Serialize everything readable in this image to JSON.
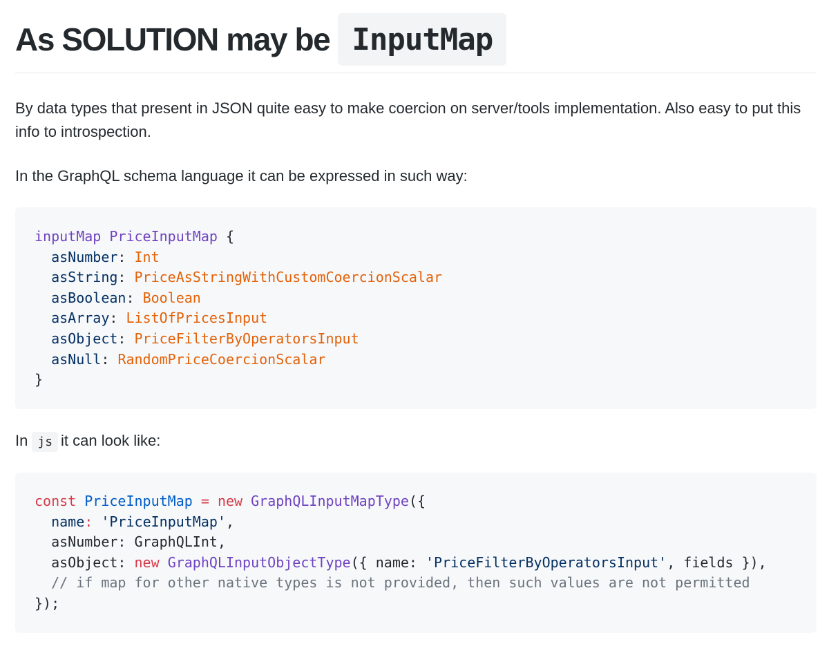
{
  "heading": {
    "text": "As SOLUTION may be",
    "code": "InputMap"
  },
  "paragraphs": {
    "p1": "By data types that present in JSON quite easy to make coercion on server/tools implementation. Also easy to put this info to introspection.",
    "p2": "In the GraphQL schema language it can be expressed in such way:",
    "p3_before": "In",
    "p3_code": "js",
    "p3_after": "it can look like:"
  },
  "graphql_code": {
    "l1": [
      "inputMap",
      "PriceInputMap",
      "{"
    ],
    "fields": [
      {
        "name": "asNumber",
        "type": "Int"
      },
      {
        "name": "asString",
        "type": "PriceAsStringWithCustomCoercionScalar"
      },
      {
        "name": "asBoolean",
        "type": "Boolean"
      },
      {
        "name": "asArray",
        "type": "ListOfPricesInput"
      },
      {
        "name": "asObject",
        "type": "PriceFilterByOperatorsInput"
      },
      {
        "name": "asNull",
        "type": "RandomPriceCoercionScalar"
      }
    ],
    "close": "}"
  },
  "js_code": {
    "l1": {
      "const": "const",
      "var": "PriceInputMap",
      "eq": "=",
      "new": "new",
      "fn": "GraphQLInputMapType",
      "open": "({"
    },
    "l2": {
      "key": "name",
      "str": "'PriceInputMap'",
      "tail": ","
    },
    "l3": {
      "key": "asNumber",
      "val": "GraphQLInt",
      "tail": ","
    },
    "l4": {
      "key": "asObject",
      "new": "new",
      "fn": "GraphQLInputObjectType",
      "open": "({",
      "key2": "name",
      "str": "'PriceFilterByOperatorsInput'",
      "rest": ", fields }),"
    },
    "l5": "// if map for other native types is not provided, then such values are not permitted",
    "l6": "});"
  }
}
